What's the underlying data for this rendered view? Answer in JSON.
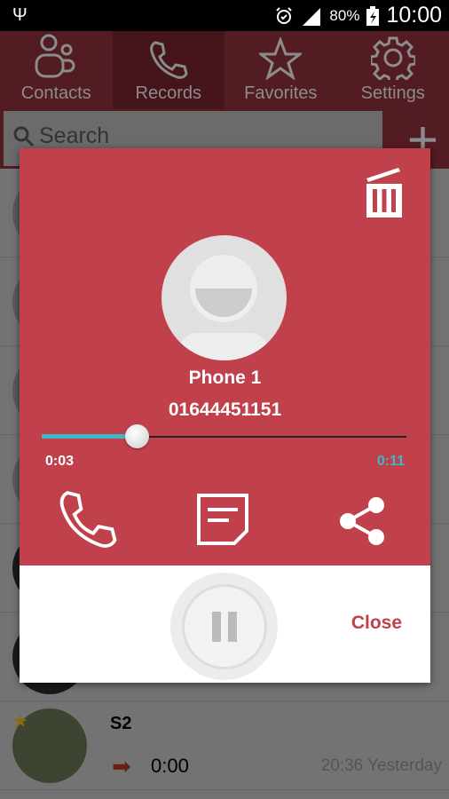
{
  "status_bar": {
    "battery": "80%",
    "time": "10:00",
    "icons": [
      "usb-icon",
      "alarm-icon",
      "signal-icon",
      "battery-charging-icon"
    ]
  },
  "tabs": [
    {
      "label": "Contacts",
      "icon": "contacts-icon",
      "active": false
    },
    {
      "label": "Records",
      "icon": "phone-icon",
      "active": true
    },
    {
      "label": "Favorites",
      "icon": "star-icon",
      "active": false
    },
    {
      "label": "Settings",
      "icon": "gear-icon",
      "active": false
    }
  ],
  "search": {
    "placeholder": "Search"
  },
  "records": [
    {
      "name": "S2",
      "duration": "0:00",
      "time": "20:36 Yesterday",
      "favorite": true
    }
  ],
  "player": {
    "name": "Phone 1",
    "number": "01644451151",
    "elapsed": "0:03",
    "total": "0:11",
    "progress": 0.26,
    "close_label": "Close",
    "state": "playing"
  },
  "colors": {
    "accent": "#c0404b",
    "progress": "#3db8c8"
  }
}
